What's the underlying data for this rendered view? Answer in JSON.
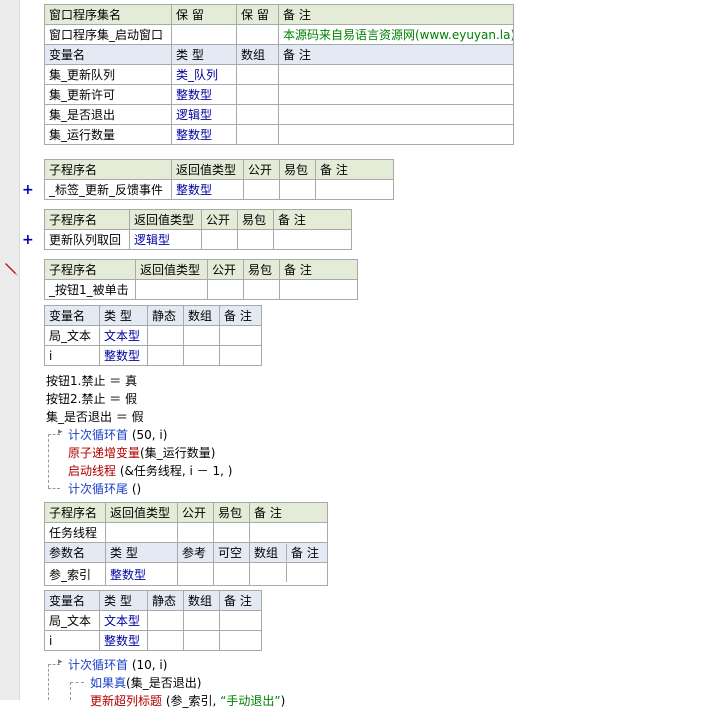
{
  "window_table": {
    "headers": [
      "窗口程序集名",
      "保 留",
      "保 留",
      "备 注"
    ],
    "row": [
      "窗口程序集_启动窗口",
      "",
      "",
      "本源码来自易语言资源网(www.eyuyan.la)"
    ],
    "var_headers": [
      "变量名",
      "类 型",
      "数组",
      "备 注"
    ],
    "vars": [
      [
        "集_更新队列",
        "类_队列"
      ],
      [
        "集_更新许可",
        "整数型"
      ],
      [
        "集_是否退出",
        "逻辑型"
      ],
      [
        "集_运行数量",
        "整数型"
      ]
    ]
  },
  "sub_headers": [
    "子程序名",
    "返回值类型",
    "公开",
    "易包",
    "备 注"
  ],
  "subs": [
    {
      "name": "_标签_更新_反馈事件",
      "ret": "整数型",
      "collapsed_icon": "+"
    },
    {
      "name": "更新队列取回",
      "ret": "逻辑型",
      "collapsed_icon": "+"
    },
    {
      "name": "_按钮1_被单击",
      "ret": ""
    }
  ],
  "local_headers": [
    "变量名",
    "类 型",
    "静态",
    "数组",
    "备 注"
  ],
  "locals1": [
    [
      "局_文本",
      "文本型"
    ],
    [
      "i",
      "整数型"
    ]
  ],
  "code1": {
    "l1": "按钮1.禁止 ＝ 真",
    "l2": "按钮2.禁止 ＝ 假",
    "l3": "集_是否退出 ＝ 假",
    "loop_start": "计次循环首",
    "loop_args": "(50, i)",
    "inc": "原子递增变量",
    "inc_args": "(集_运行数量)",
    "thread": "启动线程",
    "thread_args": "(&任务线程, i － 1, )",
    "loop_end": "计次循环尾",
    "loop_end_args": "()"
  },
  "task_sub": {
    "name": "任务线程",
    "ret": ""
  },
  "param_headers": [
    "参数名",
    "类 型",
    "参考",
    "可空",
    "数组",
    "备 注"
  ],
  "params": [
    [
      "参_索引",
      "整数型"
    ]
  ],
  "locals2": [
    [
      "局_文本",
      "文本型"
    ],
    [
      "i",
      "整数型"
    ]
  ],
  "code2": {
    "loop_start": "计次循环首",
    "loop_args": "(10, i)",
    "if_true": "如果真",
    "if_args": "(集_是否退出)",
    "update": "更新超列标题",
    "update_args_a": "(参_索引, ",
    "update_str": "“手动退出”",
    "update_args_b": ")"
  }
}
